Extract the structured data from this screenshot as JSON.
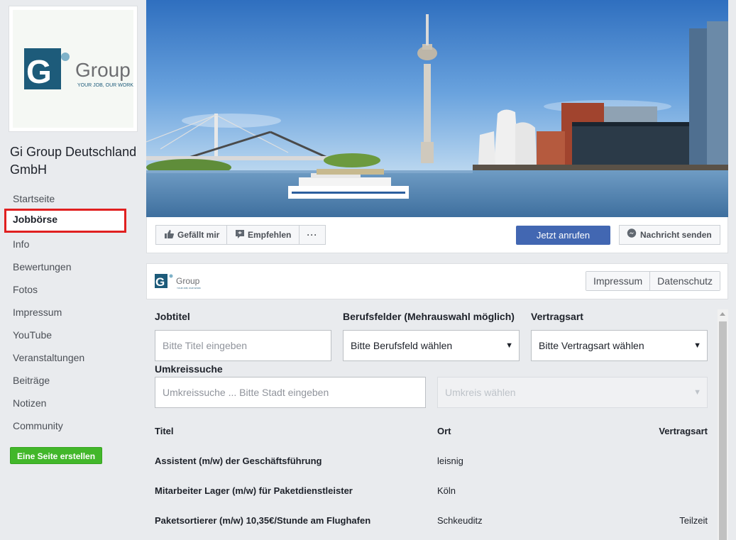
{
  "page": {
    "name": "Gi Group Deutschland GmbH"
  },
  "logo": {
    "brand": "Group",
    "tagline": "YOUR JOB, OUR WORK",
    "mark": "Gi"
  },
  "sidebar": {
    "items": [
      {
        "label": "Startseite",
        "active": false
      },
      {
        "label": "Jobbörse",
        "active": true
      },
      {
        "label": "Info",
        "active": false
      },
      {
        "label": "Bewertungen",
        "active": false
      },
      {
        "label": "Fotos",
        "active": false
      },
      {
        "label": "Impressum",
        "active": false
      },
      {
        "label": "YouTube",
        "active": false
      },
      {
        "label": "Veranstaltungen",
        "active": false
      },
      {
        "label": "Beiträge",
        "active": false
      },
      {
        "label": "Notizen",
        "active": false
      },
      {
        "label": "Community",
        "active": false
      }
    ],
    "create_page_label": "Eine Seite erstellen"
  },
  "action_bar": {
    "like_label": "Gefällt mir",
    "recommend_label": "Empfehlen",
    "more_label": "···",
    "call_label": "Jetzt anrufen",
    "message_label": "Nachricht senden"
  },
  "app": {
    "tabs": [
      "Impressum",
      "Datenschutz"
    ],
    "filters": {
      "jobtitle_label": "Jobtitel",
      "jobtitle_placeholder": "Bitte Titel eingeben",
      "field_label": "Berufsfelder (Mehrauswahl möglich)",
      "field_value": "Bitte Berufsfeld wählen",
      "contract_label": "Vertragsart",
      "contract_value": "Bitte Vertragsart wählen",
      "radius_label": "Umkreissuche",
      "radius_placeholder": "Umkreissuche ... Bitte Stadt eingeben",
      "radius_select": "Umkreis wählen"
    },
    "table": {
      "headers": {
        "title": "Titel",
        "location": "Ort",
        "contract": "Vertragsart"
      },
      "rows": [
        {
          "title": "Assistent (m/w) der Geschäftsführung",
          "location": "leisnig",
          "contract": ""
        },
        {
          "title": "Mitarbeiter Lager (m/w) für Paketdienstleister",
          "location": "Köln",
          "contract": ""
        },
        {
          "title": "Paketsortierer (m/w) 10,35€/Stunde am Flughafen",
          "location": "Schkeuditz",
          "contract": "Teilzeit"
        }
      ]
    }
  },
  "colors": {
    "fb_blue": "#4267b2",
    "green": "#42b72a",
    "highlight_red": "#e02020",
    "gi_teal": "#1d5b7a"
  }
}
